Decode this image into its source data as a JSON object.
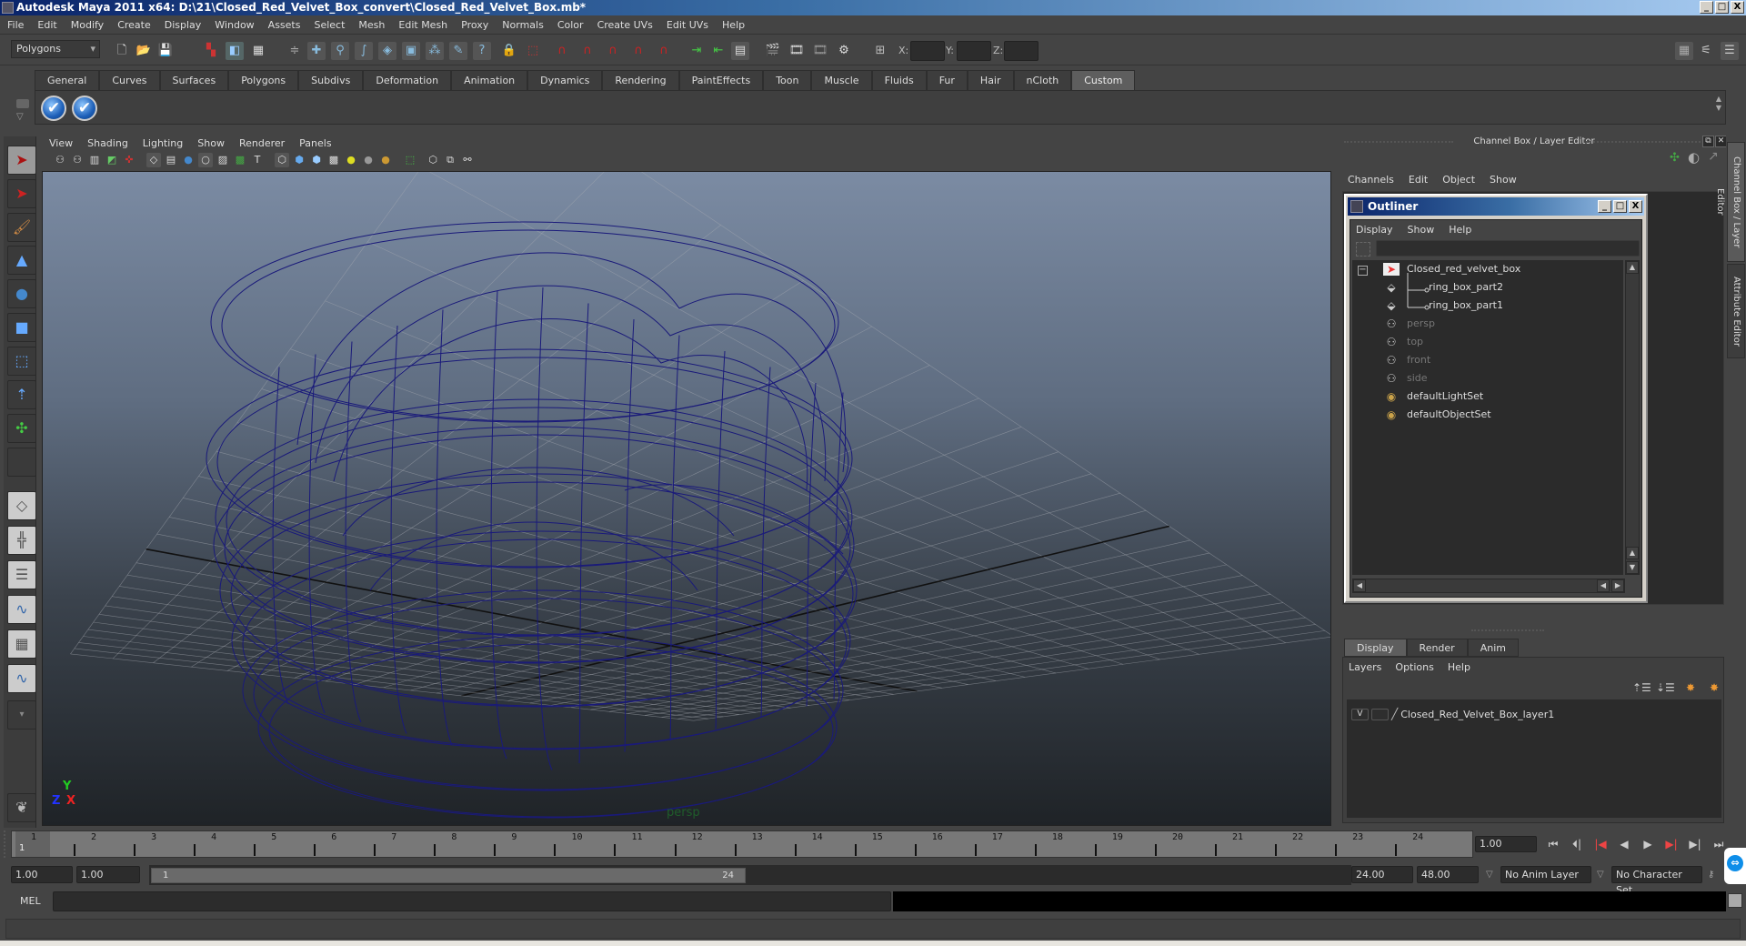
{
  "window": {
    "title": "Autodesk Maya 2011 x64: D:\\21\\Closed_Red_Velvet_Box_convert\\Closed_Red_Velvet_Box.mb*",
    "min_label": "_",
    "max_label": "□",
    "close_label": "X"
  },
  "menubar": [
    "File",
    "Edit",
    "Modify",
    "Create",
    "Display",
    "Window",
    "Assets",
    "Select",
    "Mesh",
    "Edit Mesh",
    "Proxy",
    "Normals",
    "Color",
    "Create UVs",
    "Edit UVs",
    "Help"
  ],
  "toolbar": {
    "mode": "Polygons",
    "x_label": "X:",
    "y_label": "Y:",
    "z_label": "Z:",
    "x_value": "",
    "y_value": "",
    "z_value": ""
  },
  "shelf": {
    "tabs": [
      "General",
      "Curves",
      "Surfaces",
      "Polygons",
      "Subdivs",
      "Deformation",
      "Animation",
      "Dynamics",
      "Rendering",
      "PaintEffects",
      "Toon",
      "Muscle",
      "Fluids",
      "Fur",
      "Hair",
      "nCloth",
      "Custom"
    ],
    "active_tab": "Custom",
    "buttons": [
      "check-icon",
      "check-icon"
    ]
  },
  "viewport": {
    "menu": [
      "View",
      "Shading",
      "Lighting",
      "Show",
      "Renderer",
      "Panels"
    ],
    "camera_label": "persp",
    "axis": {
      "x": "X",
      "y": "Y",
      "z": "Z"
    },
    "wireframe_color": "#1a1a7a"
  },
  "channel_box": {
    "header": "Channel Box / Layer Editor",
    "menu": [
      "Channels",
      "Edit",
      "Object",
      "Show"
    ]
  },
  "outliner": {
    "title": "Outliner",
    "menu": [
      "Display",
      "Show",
      "Help"
    ],
    "items": [
      {
        "label": "Closed_red_velvet_box",
        "icon": "transform-icon",
        "dim": false,
        "indent": 0
      },
      {
        "label": "ring_box_part2",
        "icon": "mesh-icon",
        "dim": false,
        "indent": 1
      },
      {
        "label": "ring_box_part1",
        "icon": "mesh-icon",
        "dim": false,
        "indent": 1
      },
      {
        "label": "persp",
        "icon": "camera-icon",
        "dim": true,
        "indent": 0
      },
      {
        "label": "top",
        "icon": "camera-icon",
        "dim": true,
        "indent": 0
      },
      {
        "label": "front",
        "icon": "camera-icon",
        "dim": true,
        "indent": 0
      },
      {
        "label": "side",
        "icon": "camera-icon",
        "dim": true,
        "indent": 0
      },
      {
        "label": "defaultLightSet",
        "icon": "set-icon",
        "dim": false,
        "indent": 0
      },
      {
        "label": "defaultObjectSet",
        "icon": "set-icon",
        "dim": false,
        "indent": 0
      }
    ]
  },
  "layer_editor": {
    "tabs": [
      "Display",
      "Render",
      "Anim"
    ],
    "active_tab": "Display",
    "menu": [
      "Layers",
      "Options",
      "Help"
    ],
    "layers": [
      {
        "visible": "V",
        "name": "Closed_Red_Velvet_Box_layer1"
      }
    ]
  },
  "side_tabs": [
    "Channel Box / Layer Editor",
    "Attribute Editor"
  ],
  "timeline": {
    "start": 1,
    "end": 24,
    "current": 1,
    "ticks": [
      "1",
      "2",
      "3",
      "4",
      "5",
      "6",
      "7",
      "8",
      "9",
      "10",
      "11",
      "12",
      "13",
      "14",
      "15",
      "16",
      "17",
      "18",
      "19",
      "20",
      "21",
      "22",
      "23",
      "24"
    ],
    "current_frame_field": "1.00"
  },
  "range": {
    "start_time": "1.00",
    "playback_start": "1.00",
    "slider_start": "1",
    "slider_end": "24",
    "playback_end": "24.00",
    "end_time": "48.00",
    "anim_layer": "No Anim Layer",
    "character_set": "No Character Set"
  },
  "command_line": {
    "label": "MEL",
    "input": "",
    "result": ""
  }
}
